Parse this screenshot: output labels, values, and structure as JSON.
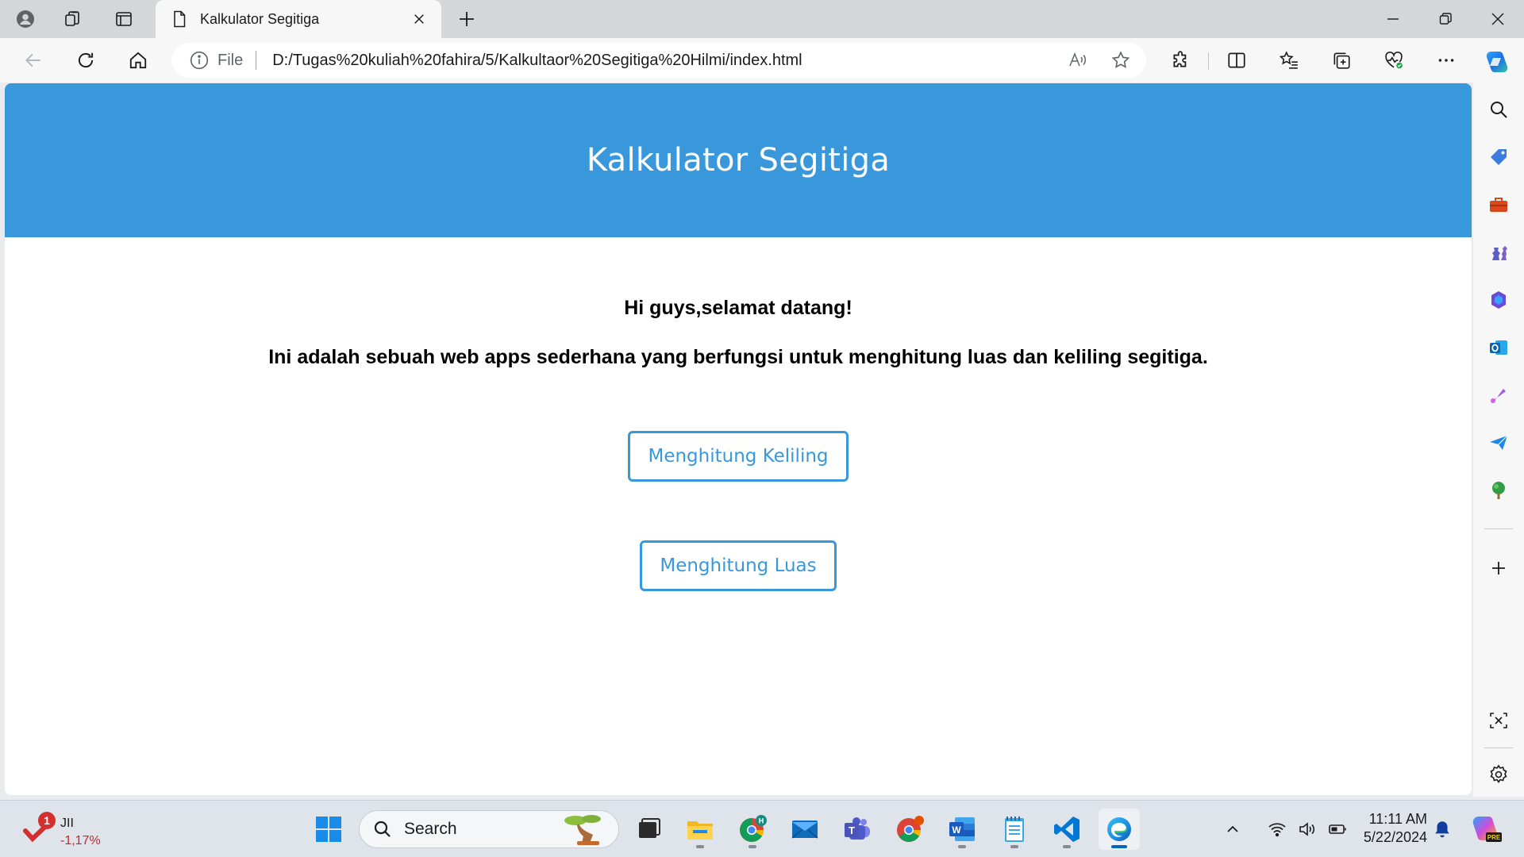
{
  "browser": {
    "tab_title": "Kalkulator Segitiga",
    "address_scheme_label": "File",
    "url": "D:/Tugas%20kuliah%20fahira/5/Kalkultaor%20Segitiga%20Hilmi/index.html"
  },
  "page": {
    "header_title": "Kalkulator Segitiga",
    "greeting": "Hi guys,selamat datang!",
    "description": "Ini adalah sebuah web apps sederhana yang berfungsi untuk menghitung luas dan keliling segitiga.",
    "button_keliling": "Menghitung Keliling",
    "button_luas": "Menghitung Luas",
    "accent_color": "#3898db"
  },
  "taskbar": {
    "widget_title": "JII",
    "widget_value": "-1,17%",
    "widget_badge": "1",
    "search_label": "Search",
    "time": "11:11 AM",
    "date": "5/22/2024"
  }
}
